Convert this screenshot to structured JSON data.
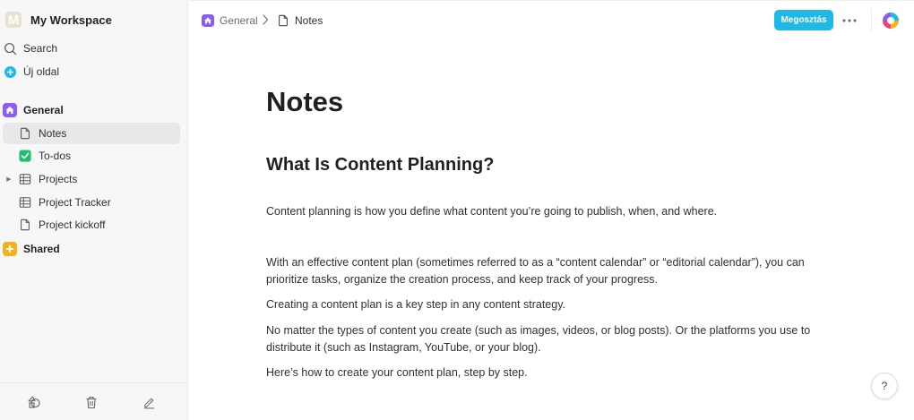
{
  "sidebar": {
    "workspace": {
      "avatar_letter": "M",
      "name": "My Workspace"
    },
    "search_label": "Search",
    "new_page_label": "Új oldal",
    "general_label": "General",
    "pages": [
      {
        "label": "Notes",
        "icon": "page-icon"
      },
      {
        "label": "To-dos",
        "icon": "checkbox-icon"
      },
      {
        "label": "Projects",
        "icon": "table-icon"
      },
      {
        "label": "Project Tracker",
        "icon": "table-icon"
      },
      {
        "label": "Project kickoff",
        "icon": "page-icon"
      }
    ],
    "shared_label": "Shared",
    "footer_icons": [
      "templates-icon",
      "trash-icon",
      "edit-icon"
    ]
  },
  "header": {
    "breadcrumb": [
      {
        "label": "General",
        "icon": "home-icon"
      },
      {
        "label": "Notes",
        "icon": "page-icon"
      }
    ],
    "share_label": "Megosztás",
    "more_icon": "ellipsis-icon"
  },
  "document": {
    "title": "Notes",
    "heading": "What Is Content Planning?",
    "paragraphs": [
      "Content planning is how you define what content you’re going to publish, when, and where.",
      "With an effective content plan (sometimes referred to as a “content calendar” or “editorial calendar”), you can prioritize tasks, organize the creation process, and keep track of your progress.",
      "Creating a content plan is a key step in any content strategy.",
      "No matter the types of content you create (such as images, videos, or blog posts). Or the platforms you use to distribute it (such as Instagram, YouTube, or your blog).",
      "Here’s how to create your content plan, step by step."
    ]
  },
  "help_label": "?",
  "colors": {
    "accent": "#1fb8e7",
    "general_icon": "#8b5cf6",
    "shared_icon": "#f6b21b",
    "todo_check": "#1fbf6b",
    "new_page_icon": "#1fb8e7"
  }
}
